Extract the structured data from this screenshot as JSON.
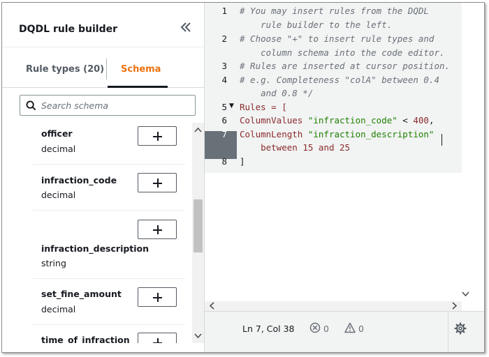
{
  "left_panel": {
    "title": "DQDL rule builder",
    "collapse_icon": "double-chevron-left-icon",
    "tabs": [
      {
        "label": "Rule types (20)",
        "active": false
      },
      {
        "label": "Schema",
        "active": true
      }
    ],
    "search": {
      "placeholder": "Search schema",
      "value": "",
      "icon": "search-icon"
    },
    "columns": [
      {
        "name": "officer",
        "type": "decimal"
      },
      {
        "name": "infraction_code",
        "type": "decimal"
      },
      {
        "name": "infraction_description",
        "type": "string"
      },
      {
        "name": "set_fine_amount",
        "type": "decimal"
      },
      {
        "name": "time_of_infraction",
        "type": ""
      }
    ],
    "add_button_label": "+"
  },
  "editor": {
    "line_numbers": [
      "1",
      "2",
      "3",
      "4",
      "5",
      "6",
      "7",
      "8"
    ],
    "lines": {
      "l1a": "# You may insert rules from the DQDL",
      "l1b": "    rule builder to the left.",
      "l2a": "# Choose \"+\" to insert rule types and",
      "l2b": "    column schema into the code editor.",
      "l3": "# Rules are inserted at cursor position.",
      "l4a": "# e.g. Completeness \"colA\" between 0.4",
      "l4b": "    and 0.8 */",
      "l5": "Rules = [",
      "l6_kw": "ColumnValues",
      "l6_str": "\"infraction_code\"",
      "l6_op": " < ",
      "l6_num": "400",
      "l6_end": ",",
      "l7_kw": "ColumnLength",
      "l7_str": "\"infraction_description\"",
      "l7b_kw1": "between",
      "l7b_n1": "15",
      "l7b_kw2": "and",
      "l7b_n2": "25",
      "l8": "]"
    }
  },
  "status_bar": {
    "cursor_position": "Ln 7, Col 38",
    "errors": "0",
    "warnings": "0",
    "settings_icon": "gear-icon"
  },
  "colors": {
    "accent": "#ec7211",
    "keyword": "#8a2b2b",
    "string": "#1d8102",
    "comment": "#687078"
  }
}
